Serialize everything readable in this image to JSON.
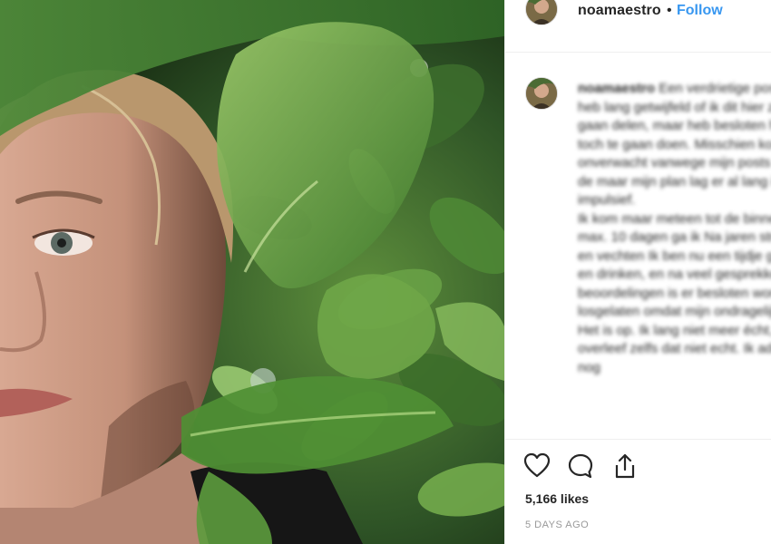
{
  "post": {
    "username": "noamaestro",
    "separator": "•",
    "follow_label": "Follow",
    "caption_user": "noamaestro",
    "caption_text": "Een verdrietige post. Ik heb lang getwijfeld of ik dit hier zou gaan delen, maar heb besloten het toch te gaan doen. Misschien komt het onverwacht vanwege mijn posts over de maar mijn plan lag er al lang is niet impulsief.\nIk kom maar meteen tot de binnen max. 10 dagen ga ik Na jaren strijden en vechten Ik ben nu een tijdje gestopt en drinken, en na veel gesprekken beoordelingen is er besloten word losgelaten omdat mijn ondragelijk is. Het is op. Ik lang niet meer écht, ik overleef zelfs dat niet echt. Ik adem nog",
    "likes": "5,166 likes",
    "timestamp": "5 DAYS AGO"
  },
  "icons": {
    "like": "heart-icon",
    "comment": "speech-bubble-icon",
    "share": "share-icon"
  },
  "colors": {
    "link": "#3897f0",
    "text": "#262626",
    "muted": "#999999",
    "foliage_dark": "#1f3b1a",
    "foliage_light": "#8fbf5a"
  }
}
